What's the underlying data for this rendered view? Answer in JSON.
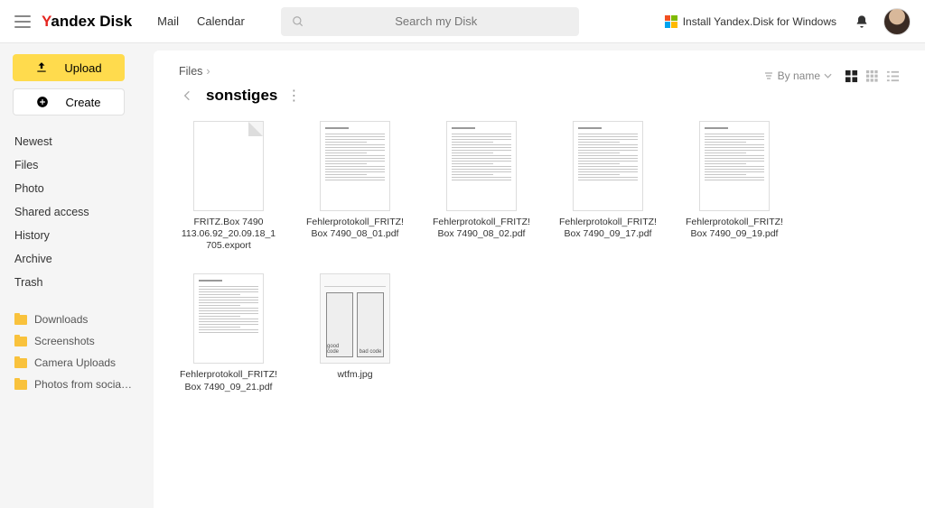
{
  "header": {
    "logo": "andex Disk",
    "links": [
      "Mail",
      "Calendar"
    ],
    "search_placeholder": "Search my Disk",
    "install_label": "Install Yandex.Disk for Windows"
  },
  "sidebar": {
    "upload_label": "Upload",
    "create_label": "Create",
    "nav": [
      "Newest",
      "Files",
      "Photo",
      "Shared access",
      "History",
      "Archive",
      "Trash"
    ],
    "folders": [
      "Downloads",
      "Screenshots",
      "Camera Uploads",
      "Photos from social ..."
    ]
  },
  "main": {
    "breadcrumb_root": "Files",
    "folder_title": "sonstiges",
    "sort_label": "By name",
    "files": [
      {
        "name": "FRITZ.Box 7490 113.06.92_20.09.18_1705.export",
        "type": "export"
      },
      {
        "name": "Fehlerprotokoll_FRITZ!Box 7490_08_01.pdf",
        "type": "pdf"
      },
      {
        "name": "Fehlerprotokoll_FRITZ!Box 7490_08_02.pdf",
        "type": "pdf"
      },
      {
        "name": "Fehlerprotokoll_FRITZ!Box 7490_09_17.pdf",
        "type": "pdf"
      },
      {
        "name": "Fehlerprotokoll_FRITZ!Box 7490_09_19.pdf",
        "type": "pdf"
      },
      {
        "name": "Fehlerprotokoll_FRITZ!Box 7490_09_21.pdf",
        "type": "pdf"
      },
      {
        "name": "wtfm.jpg",
        "type": "img"
      }
    ]
  }
}
